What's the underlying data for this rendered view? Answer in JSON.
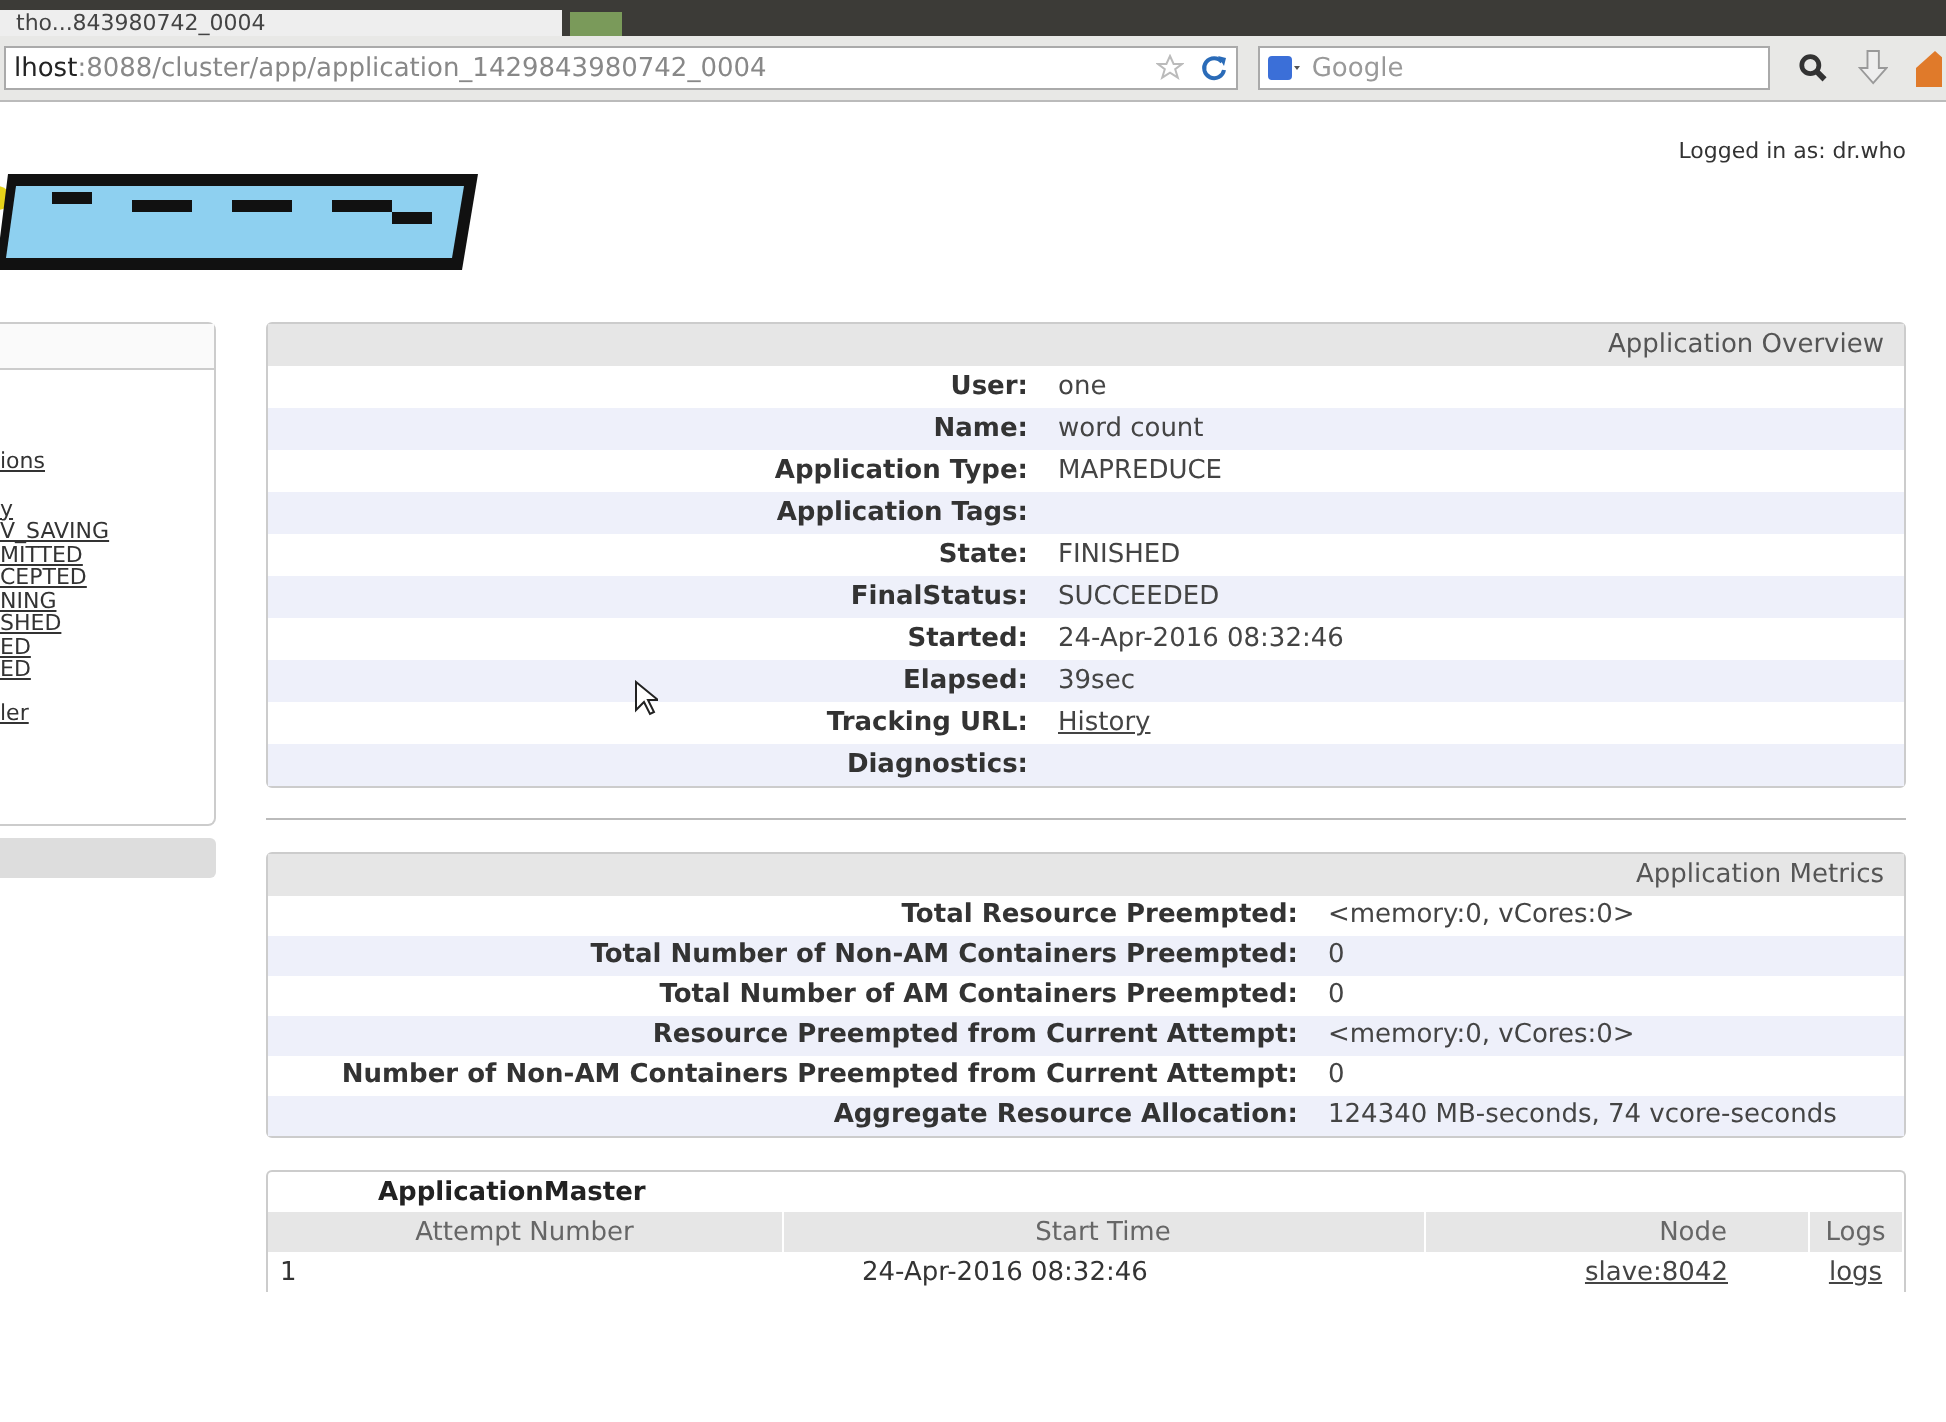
{
  "browser": {
    "tab_title": "tho...843980742_0004",
    "url_host": "lhost",
    "url_rest": ":8088/cluster/app/application_1429843980742_0004",
    "search_placeholder": "Google"
  },
  "header": {
    "logged_in": "Logged in as: dr.who"
  },
  "sidebar": {
    "links": [
      "ions",
      "y",
      "V_SAVING",
      "MITTED",
      "CEPTED",
      "NING",
      "SHED",
      "ED",
      "ED",
      "ler"
    ]
  },
  "overview": {
    "title": "Application Overview",
    "rows": [
      {
        "label": "User:",
        "value": "one",
        "kind": "text"
      },
      {
        "label": "Name:",
        "value": "word count",
        "kind": "text"
      },
      {
        "label": "Application Type:",
        "value": "MAPREDUCE",
        "kind": "text"
      },
      {
        "label": "Application Tags:",
        "kind": "text"
      },
      {
        "label": "State:",
        "value": "FINISHED",
        "kind": "text"
      },
      {
        "label": "FinalStatus:",
        "value": "SUCCEEDED",
        "kind": "text"
      },
      {
        "label": "Started:",
        "value": "24-Apr-2016 08:32:46",
        "kind": "text"
      },
      {
        "label": "Elapsed:",
        "value": "39sec",
        "kind": "text"
      },
      {
        "label": "Tracking URL:",
        "value": "History",
        "kind": "link"
      },
      {
        "label": "Diagnostics:",
        "kind": "text"
      }
    ]
  },
  "metrics": {
    "title": "Application Metrics",
    "rows": [
      {
        "label": "Total Resource Preempted:",
        "value": "<memory:0, vCores:0>"
      },
      {
        "label": "Total Number of Non-AM Containers Preempted:",
        "value": "0"
      },
      {
        "label": "Total Number of AM Containers Preempted:",
        "value": "0"
      },
      {
        "label": "Resource Preempted from Current Attempt:",
        "value": "<memory:0, vCores:0>"
      },
      {
        "label": "Number of Non-AM Containers Preempted from Current Attempt:",
        "value": "0"
      },
      {
        "label": "Aggregate Resource Allocation:",
        "value": "124340 MB-seconds, 74 vcore-seconds"
      }
    ]
  },
  "attempts": {
    "title": "ApplicationMaster",
    "columns": [
      "Attempt Number",
      "Start Time",
      "Node",
      "Logs"
    ],
    "rows": [
      {
        "cells": [
          {
            "text": "1",
            "kind": "text"
          },
          {
            "text": "24-Apr-2016 08:32:46",
            "kind": "text"
          },
          {
            "text": "slave:8042",
            "kind": "link"
          },
          {
            "text": "logs",
            "kind": "link"
          }
        ]
      }
    ]
  }
}
